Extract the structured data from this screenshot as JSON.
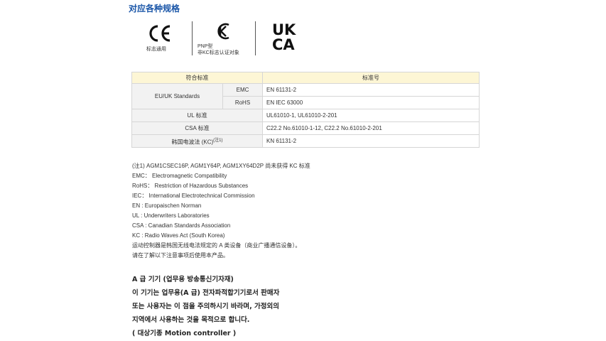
{
  "heading": "对应各种规格",
  "logos": {
    "ce": {
      "icon": "ce-mark-icon",
      "caption": "标志通用"
    },
    "kc": {
      "icon": "kc-mark-icon",
      "caption_line1": "PNP型",
      "caption_line2": "非KC标志认证对象"
    },
    "ukca": {
      "icon": "ukca-mark-icon",
      "top": "UK",
      "bottom": "CA"
    }
  },
  "table": {
    "header_standard": "符合标准",
    "header_number": "标准号",
    "rows": {
      "euuk": {
        "label": "EU/UK Standards",
        "emc_label": "EMC",
        "emc_value": "EN 61131-2",
        "rohs_label": "RoHS",
        "rohs_value": "EN IEC 63000"
      },
      "ul": {
        "label": "UL 标准",
        "value": "UL61010-1, UL61010-2-201"
      },
      "csa": {
        "label": "CSA 标准",
        "value": "C22.2 No.61010-1-12, C22.2 No.61010-2-201"
      },
      "kc": {
        "label": "韩国电波法 (KC)",
        "sup": "(注1)",
        "value": "KN 61131-2"
      }
    }
  },
  "notes": [
    "(注1) AGM1CSEC16P, AGM1Y64P, AGM1XY64D2P 尚未获得 KC 标准",
    "EMC： Electromagnetic Compatibility",
    "RoHS： Restriction of Hazardous Substances",
    "IEC： International Electrotechnical Commission",
    "EN : Europaischen Norman",
    "UL : Underwriters Laboratories",
    "CSA : Canadian Standards Association",
    "KC : Radio Waves Act (South Korea)",
    "运动控制器是韩国无线电法规定的 A 类设备（商业广播通信设备）。",
    "请在了解以下注意事项后使用本产品。"
  ],
  "korean_notice": [
    "A 급 기기 (업무용 방송통신기자재)",
    "이 기기는 업무용(A 급) 전자파적합기기로서 판매자",
    "또는 사용자는 이 점을 주의하시기 바라며, 가정외의",
    "지역에서 사용하는 것을 목적으로 합니다.",
    "( 대상기종   Motion controller  )"
  ]
}
